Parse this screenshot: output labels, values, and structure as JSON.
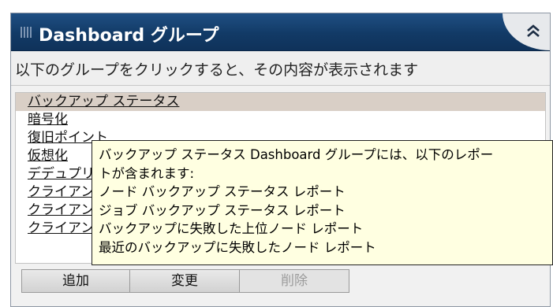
{
  "header": {
    "title": "Dashboard グループ",
    "collapse_icon": "double-chevron-up-icon",
    "grip_icon": "grip-icon"
  },
  "subtitle": "以下のグループをクリックすると、その内容が表示されます",
  "groups": [
    {
      "label": "バックアップ ステータス",
      "selected": true
    },
    {
      "label": "暗号化",
      "selected": false
    },
    {
      "label": "復旧ポイント",
      "selected": false
    },
    {
      "label": "仮想化",
      "selected": false
    },
    {
      "label": "デデュプリケーション",
      "selected": false
    },
    {
      "label": "クライアント",
      "selected": false
    },
    {
      "label": "クライアント",
      "selected": false
    },
    {
      "label": "クライアント",
      "selected": false
    }
  ],
  "buttons": {
    "add": "追加",
    "change": "変更",
    "delete": "削除"
  },
  "tooltip": {
    "lines": [
      "バックアップ ステータス Dashboard グループには、以下のレポー",
      "トが含まれます:",
      "ノード バックアップ ステータス レポート",
      "ジョブ バックアップ ステータス レポート",
      "バックアップに失敗した上位ノード レポート",
      "最近のバックアップに失敗したノード レポート"
    ]
  },
  "colors": {
    "header_bg": "#123a66",
    "selected_row": "#d9cfc6",
    "tooltip_bg": "#ffffe1"
  }
}
